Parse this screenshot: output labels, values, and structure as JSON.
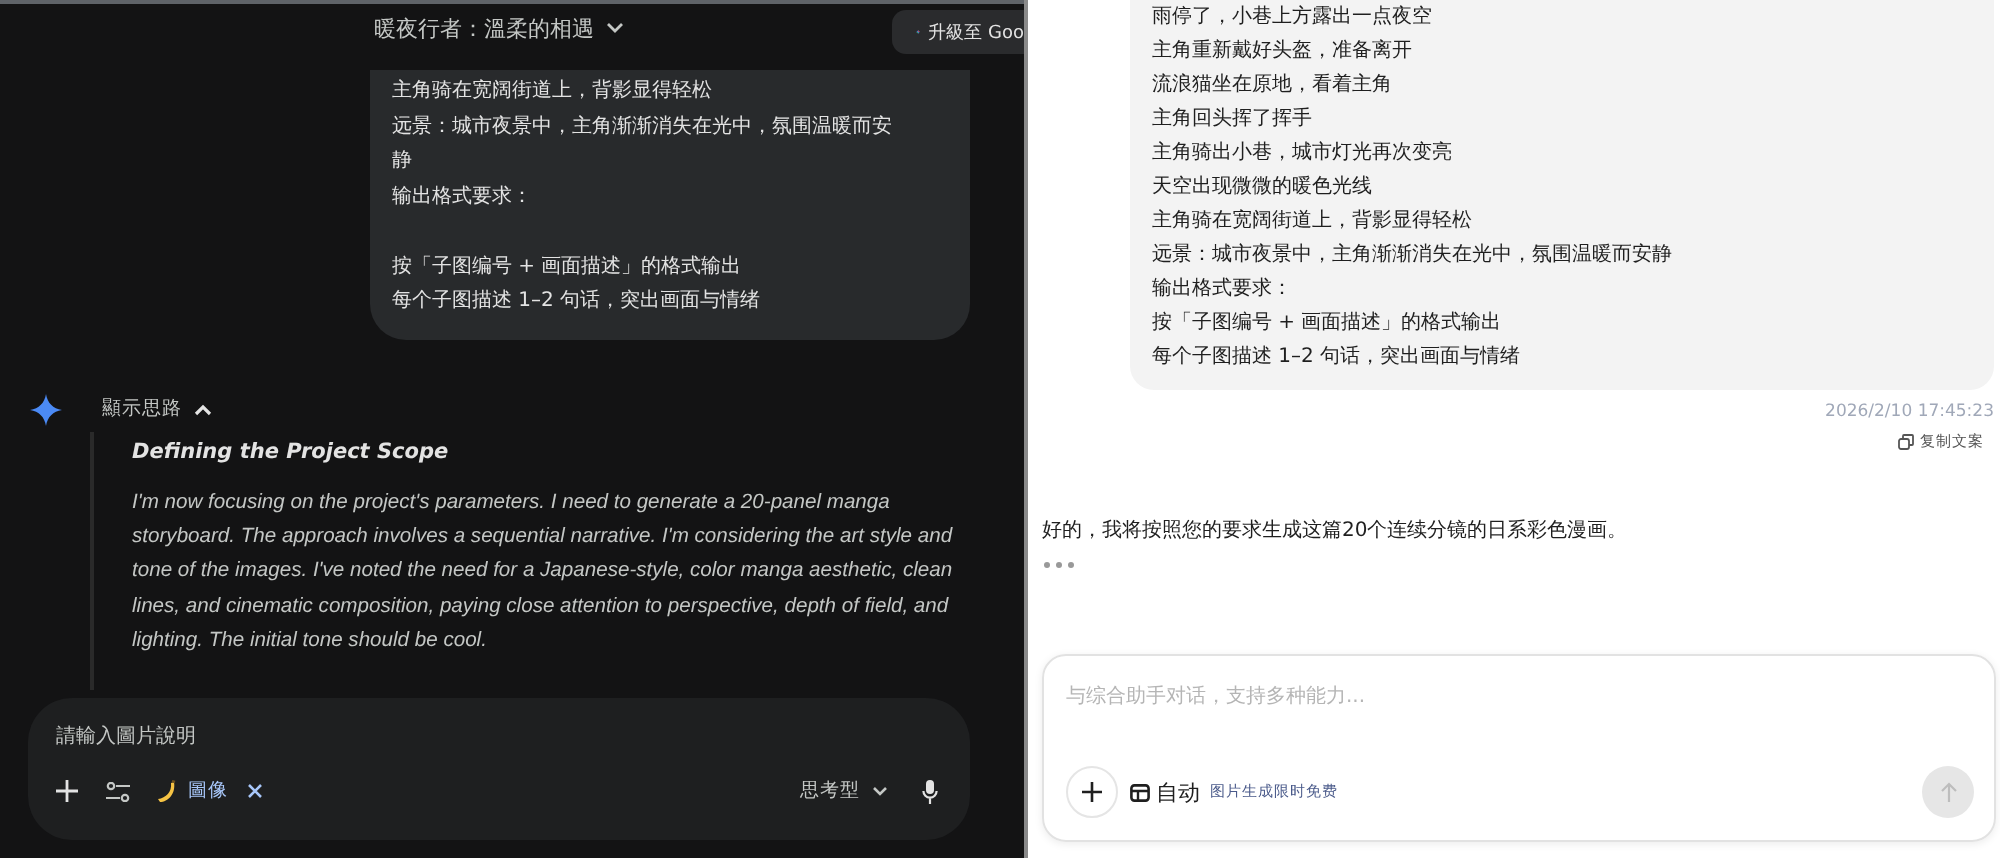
{
  "left": {
    "title": "暖夜行者：溫柔的相遇",
    "upgrade_label": "升級至 Goo",
    "user_message": {
      "lines": [
        {
          "text": "主角骑在宽阔街道上，背影显得轻松",
          "blank_before": false
        },
        {
          "text": "远景：城市夜景中，主角渐渐消失在光中，氛围温暖而安静",
          "blank_before": false
        },
        {
          "text": "输出格式要求：",
          "blank_before": false
        },
        {
          "text": "按「子图编号 + 画面描述」的格式输出",
          "blank_before": true
        },
        {
          "text": "每个子图描述 1–2 句话，突出画面与情绪",
          "blank_before": false
        }
      ]
    },
    "thoughts": {
      "label": "顯示思路",
      "expanded": true,
      "title": "Defining the Project Scope",
      "text": "I'm now focusing on the project's parameters. I need to generate a 20-panel manga storyboard. The approach involves a sequential narrative. I'm considering the art style and tone of the images. I've noted the need for a Japanese-style, color manga aesthetic, clean lines, and cinematic composition, paying close attention to perspective, depth of field, and lighting. The initial tone should be cool."
    },
    "composer": {
      "placeholder": "請輸入圖片說明",
      "tool_chip": "圖像",
      "mode": "思考型"
    }
  },
  "right": {
    "user_message": {
      "lines": [
        {
          "text": "雨停了，小巷上方露出一点夜空"
        },
        {
          "text": "主角重新戴好头盔，准备离开"
        },
        {
          "text": "流浪猫坐在原地，看着主角"
        },
        {
          "text": "主角回头挥了挥手"
        },
        {
          "text": "主角骑出小巷，城市灯光再次变亮"
        },
        {
          "text": "天空出现微微的暖色光线"
        },
        {
          "text": "主角骑在宽阔街道上，背影显得轻松"
        },
        {
          "text": "远景：城市夜景中，主角渐渐消失在光中，氛围温暖而安静"
        },
        {
          "text": "输出格式要求："
        },
        {
          "text": "按「子图编号 + 画面描述」的格式输出"
        },
        {
          "text": "每个子图描述 1–2 句话，突出画面与情绪"
        }
      ]
    },
    "timestamp": "2026/2/10 17:45:23",
    "copy_label": "复制文案",
    "reply": "好的，我将按照您的要求生成这篇20个连续分镜的日系彩色漫画。",
    "typing": true,
    "composer": {
      "placeholder": "与综合助手对话，支持多种能力...",
      "mode": "自动",
      "promo": "图片生成限时免费",
      "send_disabled": true
    }
  }
}
